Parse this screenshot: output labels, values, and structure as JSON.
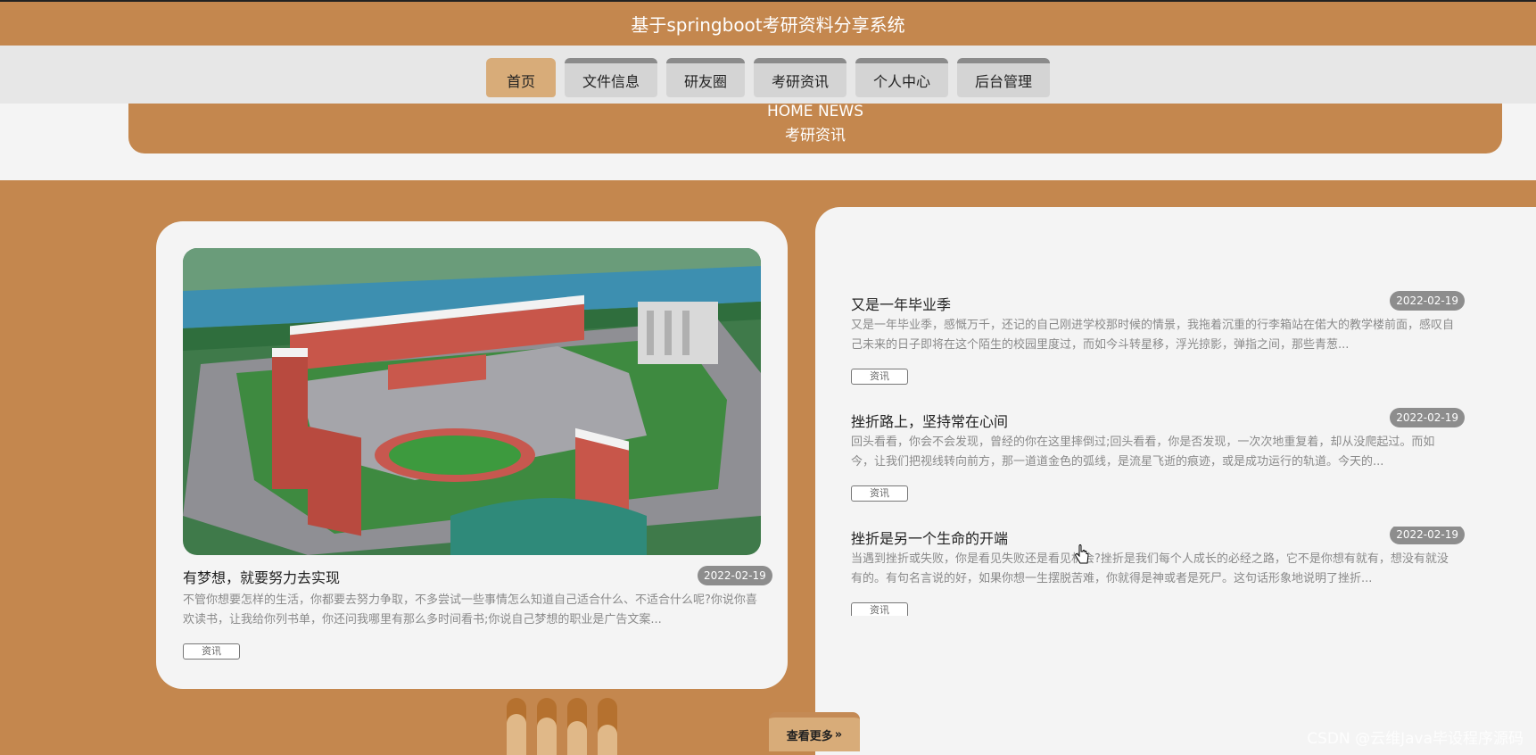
{
  "site": {
    "title": "基于springboot考研资料分享系统"
  },
  "nav": {
    "items": [
      {
        "label": "首页",
        "active": true
      },
      {
        "label": "文件信息",
        "active": false
      },
      {
        "label": "研友圈",
        "active": false
      },
      {
        "label": "考研资讯",
        "active": false
      },
      {
        "label": "个人中心",
        "active": false
      },
      {
        "label": "后台管理",
        "active": false
      }
    ]
  },
  "banner": {
    "en": "HOME NEWS",
    "cn": "考研资讯"
  },
  "featured": {
    "title": "有梦想，就要努力去实现",
    "date": "2022-02-19",
    "summary": "不管你想要怎样的生活，你都要去努力争取，不多尝试一些事情怎么知道自己适合什么、不适合什么呢?你说你喜欢读书，让我给你列书单，你还问我哪里有那么多时间看书;你说自己梦想的职业是广告文案...",
    "tag": "资讯"
  },
  "news": [
    {
      "title": "又是一年毕业季",
      "date": "2022-02-19",
      "summary": "又是一年毕业季，感慨万千，还记的自己刚进学校那时候的情景，我拖着沉重的行李箱站在偌大的教学楼前面，感叹自己未来的日子即将在这个陌生的校园里度过，而如今斗转星移，浮光掠影，弹指之间，那些青葱...",
      "tag": "资讯"
    },
    {
      "title": "挫折路上，坚持常在心间",
      "date": "2022-02-19",
      "summary": "回头看看，你会不会发现，曾经的你在这里摔倒过;回头看看，你是否发现，一次次地重复着，却从没爬起过。而如今，让我们把视线转向前方，那一道道金色的弧线，是流星飞逝的痕迹，或是成功运行的轨道。今天的...",
      "tag": "资讯"
    },
    {
      "title": "挫折是另一个生命的开端",
      "date": "2022-02-19",
      "summary": "当遇到挫折或失败，你是看见失败还是看见机会?挫折是我们每个人成长的必经之路，它不是你想有就有，想没有就没有的。有句名言说的好，如果你想一生摆脱苦难，你就得是神或者是死尸。这句话形象地说明了挫折...",
      "tag": "资讯"
    }
  ],
  "more": {
    "label": "查看更多",
    "icon": "double-chevron-right-icon"
  },
  "watermark": "CSDN @云维Java毕设程序源码",
  "colors": {
    "brand": "#c4874e",
    "active_tab": "#d8ac79",
    "date_pill": "#8d8d8d"
  }
}
